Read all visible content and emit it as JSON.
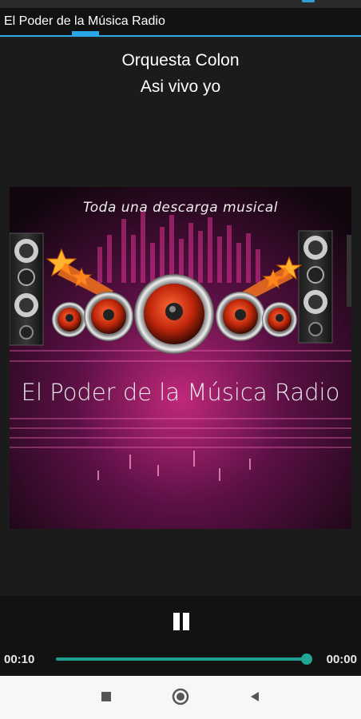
{
  "app": {
    "tab_title": "El Poder de la Música Radio"
  },
  "now_playing": {
    "artist": "Orquesta Colon",
    "song": "Asi vivo yo"
  },
  "artwork": {
    "tagline": "Toda una descarga musical",
    "station_name": "El Poder de la Música Radio"
  },
  "player": {
    "state_icon": "pause-icon",
    "elapsed": "00:10",
    "total": "00:00",
    "progress_fraction": 1.0,
    "accent_color": "#1e9e8f",
    "tab_accent_color": "#2aa7e6"
  },
  "navbar": {
    "icons": [
      "recent-apps-icon",
      "home-icon",
      "back-icon"
    ]
  }
}
